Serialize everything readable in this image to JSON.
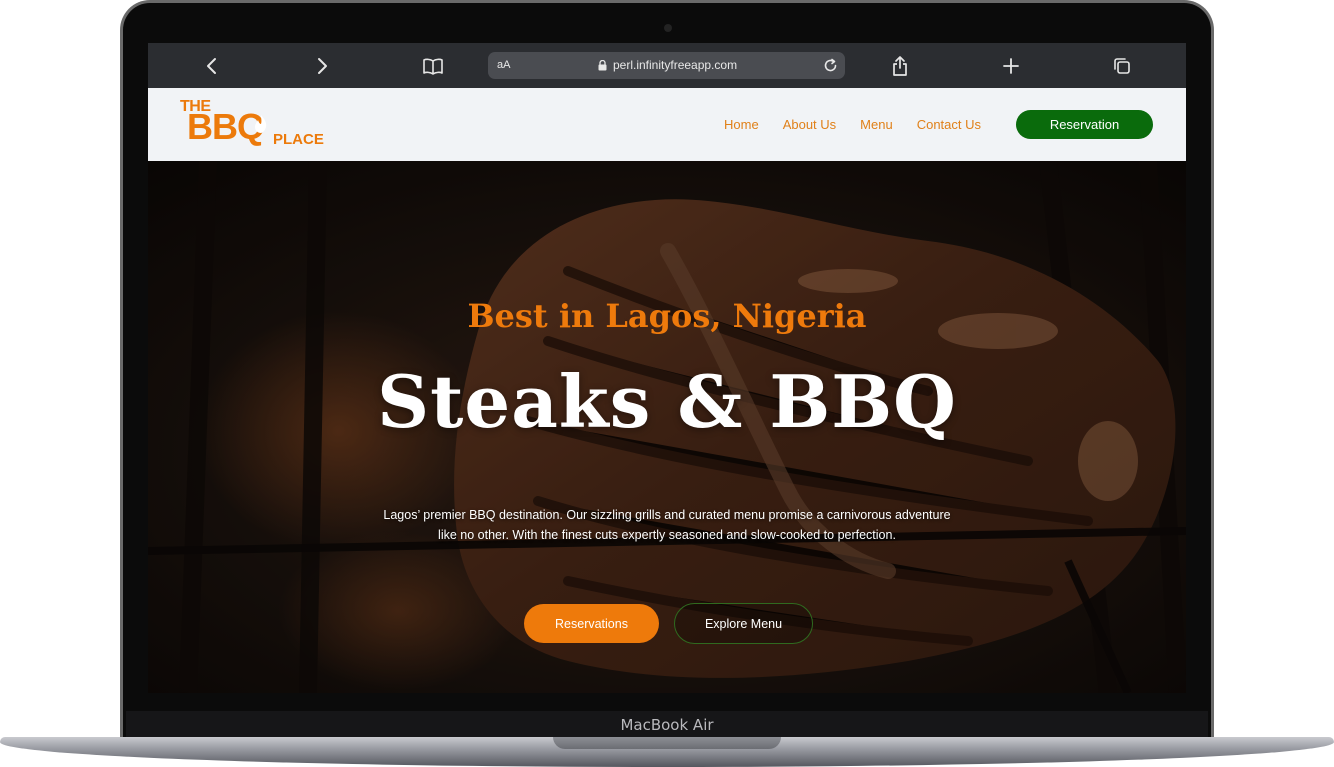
{
  "browser": {
    "text_size_label": "aA",
    "url": "perl.infinityfreeapp.com"
  },
  "logo": {
    "the": "THE",
    "bbq": "BBQ",
    "place": "PLACE"
  },
  "nav": {
    "items": [
      {
        "label": "Home"
      },
      {
        "label": "About Us"
      },
      {
        "label": "Menu"
      },
      {
        "label": "Contact Us"
      }
    ],
    "reservation_label": "Reservation"
  },
  "hero": {
    "tagline": "Best in Lagos, Nigeria",
    "title": "Steaks & BBQ",
    "description": "Lagos’ premier BBQ destination. Our sizzling grills and curated menu promise a carnivorous adventure like no other. With the finest cuts expertly seasoned and slow-cooked to perfection.",
    "primary_button": "Reservations",
    "secondary_button": "Explore Menu"
  },
  "device": {
    "label": "MacBook Air"
  },
  "colors": {
    "brand_orange": "#ec7a0b",
    "brand_green": "#0a6b0c",
    "header_bg": "#f1f3f6",
    "toolbar_bg": "#2b2d31"
  }
}
